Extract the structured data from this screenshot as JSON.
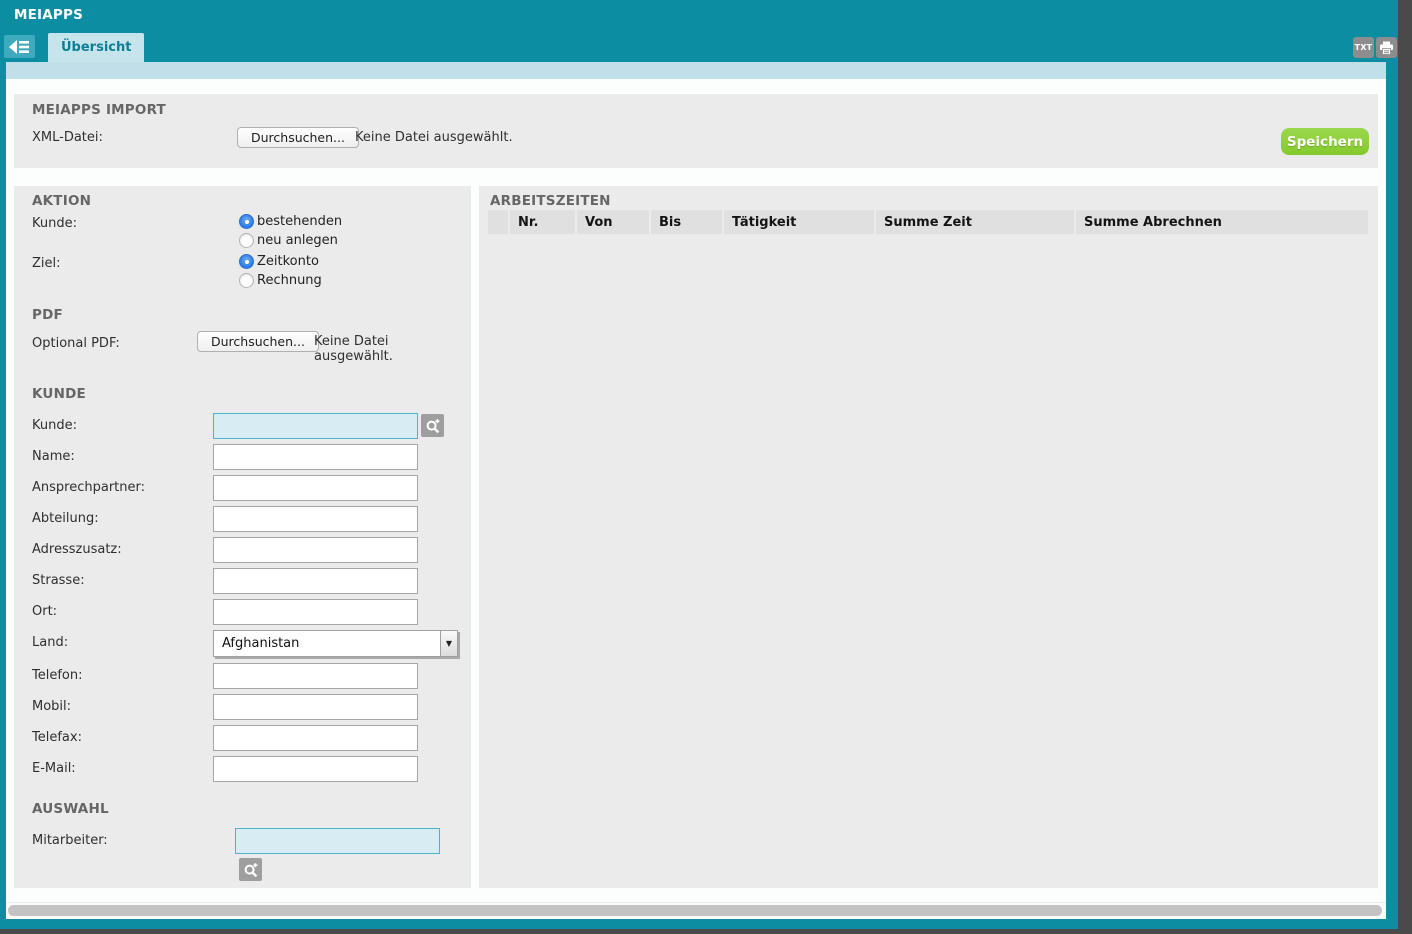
{
  "colors": {
    "teal": "#0d8da1",
    "teal_light": "#3fa9bd",
    "tab_fill": "#c6e4eb",
    "strip": "#c0dfe8",
    "lime": "#84c92c",
    "panel_gray": "#ebebeb",
    "highlight_bg": "#d8edf3",
    "highlight_border": "#4db3c8",
    "radio_blue": "#2f7de8"
  },
  "titlebar": {
    "app_title": "MEIAPPS"
  },
  "tabbar": {
    "tab_label": "Übersicht",
    "txt_icon_label": "TXT"
  },
  "import_section": {
    "title": "MEIAPPS IMPORT",
    "xml_label": "XML-Datei:",
    "browse_button": "Durchsuchen...",
    "file_status": "Keine Datei ausgewählt.",
    "save_button": "Speichern"
  },
  "aktion_section": {
    "title": "AKTION",
    "kunde_label": "Kunde:",
    "kunde_options": [
      {
        "label": "bestehenden",
        "selected": true
      },
      {
        "label": "neu anlegen",
        "selected": false
      }
    ],
    "ziel_label": "Ziel:",
    "ziel_options": [
      {
        "label": "Zeitkonto",
        "selected": true
      },
      {
        "label": "Rechnung",
        "selected": false
      }
    ]
  },
  "pdf_section": {
    "title": "PDF",
    "optional_pdf_label": "Optional PDF:",
    "browse_button": "Durchsuchen...",
    "file_status": "Keine Datei ausgewählt."
  },
  "kunde_section": {
    "title": "KUNDE",
    "fields": [
      {
        "label": "Kunde:",
        "value": ""
      },
      {
        "label": "Name:",
        "value": ""
      },
      {
        "label": "Ansprechpartner:",
        "value": ""
      },
      {
        "label": "Abteilung:",
        "value": ""
      },
      {
        "label": "Adresszusatz:",
        "value": ""
      },
      {
        "label": "Strasse:",
        "value": ""
      },
      {
        "label": "Ort:",
        "value": ""
      },
      {
        "label": "Land:",
        "value": "Afghanistan"
      },
      {
        "label": "Telefon:",
        "value": ""
      },
      {
        "label": "Mobil:",
        "value": ""
      },
      {
        "label": "Telefax:",
        "value": ""
      },
      {
        "label": "E-Mail:",
        "value": ""
      }
    ]
  },
  "auswahl_section": {
    "title": "AUSWAHL",
    "mitarbeiter_label": "Mitarbeiter:",
    "mitarbeiter_value": ""
  },
  "arbeitszeiten_section": {
    "title": "ARBEITSZEITEN",
    "columns": [
      "",
      "Nr.",
      "Von",
      "Bis",
      "Tätigkeit",
      "Summe Zeit",
      "Summe Abrechnen"
    ],
    "rows": []
  }
}
